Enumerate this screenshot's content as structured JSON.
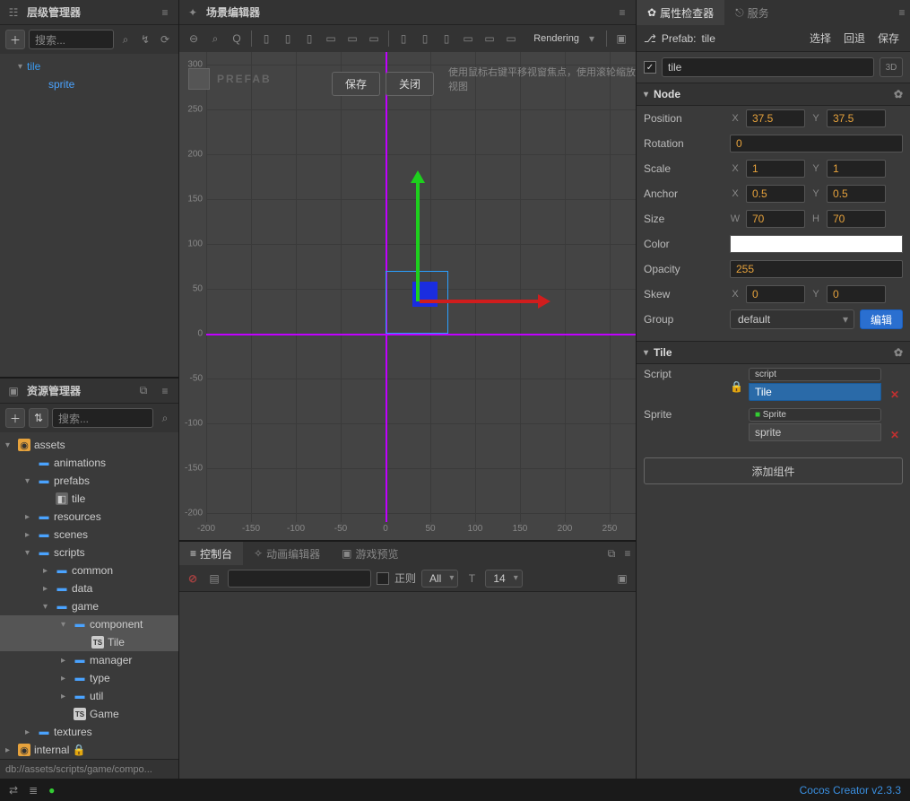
{
  "hierarchy": {
    "title": "层级管理器",
    "search_placeholder": "搜索...",
    "items": [
      {
        "label": "tile",
        "indent": 20,
        "expanded": true
      },
      {
        "label": "sprite",
        "indent": 44,
        "expanded": false
      }
    ]
  },
  "assets": {
    "title": "资源管理器",
    "search_placeholder": "搜索...",
    "footer_path": "db://assets/scripts/game/compo...",
    "tree": [
      {
        "lbl": "assets",
        "ico": "pkg",
        "indent": 6,
        "tri": "▾"
      },
      {
        "lbl": "animations",
        "ico": "folder",
        "indent": 28,
        "tri": ""
      },
      {
        "lbl": "prefabs",
        "ico": "folder",
        "indent": 28,
        "tri": "▾"
      },
      {
        "lbl": "tile",
        "ico": "prefab",
        "indent": 48,
        "tri": ""
      },
      {
        "lbl": "resources",
        "ico": "folder",
        "indent": 28,
        "tri": "▸"
      },
      {
        "lbl": "scenes",
        "ico": "folder",
        "indent": 28,
        "tri": "▸"
      },
      {
        "lbl": "scripts",
        "ico": "folder",
        "indent": 28,
        "tri": "▾"
      },
      {
        "lbl": "common",
        "ico": "folder",
        "indent": 48,
        "tri": "▸"
      },
      {
        "lbl": "data",
        "ico": "folder",
        "indent": 48,
        "tri": "▸"
      },
      {
        "lbl": "game",
        "ico": "folder",
        "indent": 48,
        "tri": "▾"
      },
      {
        "lbl": "component",
        "ico": "folder",
        "indent": 68,
        "tri": "▾",
        "selected": true
      },
      {
        "lbl": "Tile",
        "ico": "ts",
        "indent": 88,
        "tri": "",
        "selected": true
      },
      {
        "lbl": "manager",
        "ico": "folder",
        "indent": 68,
        "tri": "▸"
      },
      {
        "lbl": "type",
        "ico": "folder",
        "indent": 68,
        "tri": "▸"
      },
      {
        "lbl": "util",
        "ico": "folder",
        "indent": 68,
        "tri": "▸"
      },
      {
        "lbl": "Game",
        "ico": "ts",
        "indent": 68,
        "tri": ""
      },
      {
        "lbl": "textures",
        "ico": "folder",
        "indent": 28,
        "tri": "▸"
      },
      {
        "lbl": "internal 🔒",
        "ico": "pkg",
        "indent": 6,
        "tri": "▸"
      }
    ]
  },
  "scene": {
    "title": "场景编辑器",
    "watermark": "PREFAB",
    "save": "保存",
    "close": "关闭",
    "hint": "使用鼠标右键平移视窗焦点，使用滚轮缩放视图",
    "rendering": "Rendering",
    "y_ticks": [
      "300",
      "250",
      "200",
      "150",
      "100",
      "50",
      "0",
      "-50",
      "-100",
      "-150",
      "-200"
    ],
    "x_ticks": [
      "-200",
      "-150",
      "-100",
      "-50",
      "0",
      "50",
      "100",
      "150",
      "200",
      "250"
    ]
  },
  "console": {
    "tab_console": "控制台",
    "tab_anim": "动画编辑器",
    "tab_preview": "游戏预览",
    "regex": "正则",
    "filter_all": "All",
    "font_size": "14"
  },
  "inspector": {
    "tab_inspector": "属性检查器",
    "tab_service": "服务",
    "prefab_label": "Prefab:",
    "prefab_name": "tile",
    "select": "选择",
    "revert": "回退",
    "save": "保存",
    "node_name": "tile",
    "badge3d": "3D",
    "section_node": "Node",
    "section_tile": "Tile",
    "props": {
      "position": {
        "label": "Position",
        "x": "37.5",
        "y": "37.5"
      },
      "rotation": {
        "label": "Rotation",
        "v": "0"
      },
      "scale": {
        "label": "Scale",
        "x": "1",
        "y": "1"
      },
      "anchor": {
        "label": "Anchor",
        "x": "0.5",
        "y": "0.5"
      },
      "size": {
        "label": "Size",
        "w": "70",
        "h": "70"
      },
      "color": {
        "label": "Color",
        "hex": "#ffffff"
      },
      "opacity": {
        "label": "Opacity",
        "v": "255"
      },
      "skew": {
        "label": "Skew",
        "x": "0",
        "y": "0"
      },
      "group": {
        "label": "Group",
        "v": "default",
        "edit": "编辑"
      }
    },
    "tile": {
      "script_label": "Script",
      "script_tag": "script",
      "script_value": "Tile",
      "sprite_label": "Sprite",
      "sprite_tag": "Sprite",
      "sprite_value": "sprite"
    },
    "add_component": "添加组件"
  },
  "footer": {
    "brand": "Cocos Creator v2.3.3"
  }
}
